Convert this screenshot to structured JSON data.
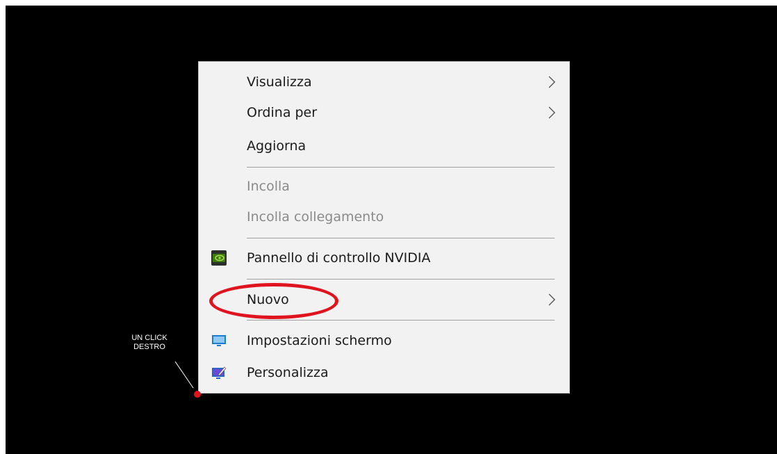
{
  "context_menu": {
    "items": [
      {
        "label": "Visualizza",
        "enabled": true,
        "submenu": true
      },
      {
        "label": "Ordina per",
        "enabled": true,
        "submenu": true
      },
      {
        "label": "Aggiorna",
        "enabled": true,
        "submenu": false
      },
      {
        "label": "Incolla",
        "enabled": false,
        "submenu": false
      },
      {
        "label": "Incolla collegamento",
        "enabled": false,
        "submenu": false
      },
      {
        "label": "Pannello di controllo NVIDIA",
        "enabled": true,
        "submenu": false,
        "icon": "nvidia-icon"
      },
      {
        "label": "Nuovo",
        "enabled": true,
        "submenu": true,
        "highlighted_by_annotation": true
      },
      {
        "label": "Impostazioni schermo",
        "enabled": true,
        "submenu": false,
        "icon": "display-icon"
      },
      {
        "label": "Personalizza",
        "enabled": true,
        "submenu": false,
        "icon": "personalize-icon"
      }
    ]
  },
  "annotation": {
    "line1": "UN CLICK",
    "line2": "DESTRO",
    "highlight_color": "#e0141e"
  }
}
